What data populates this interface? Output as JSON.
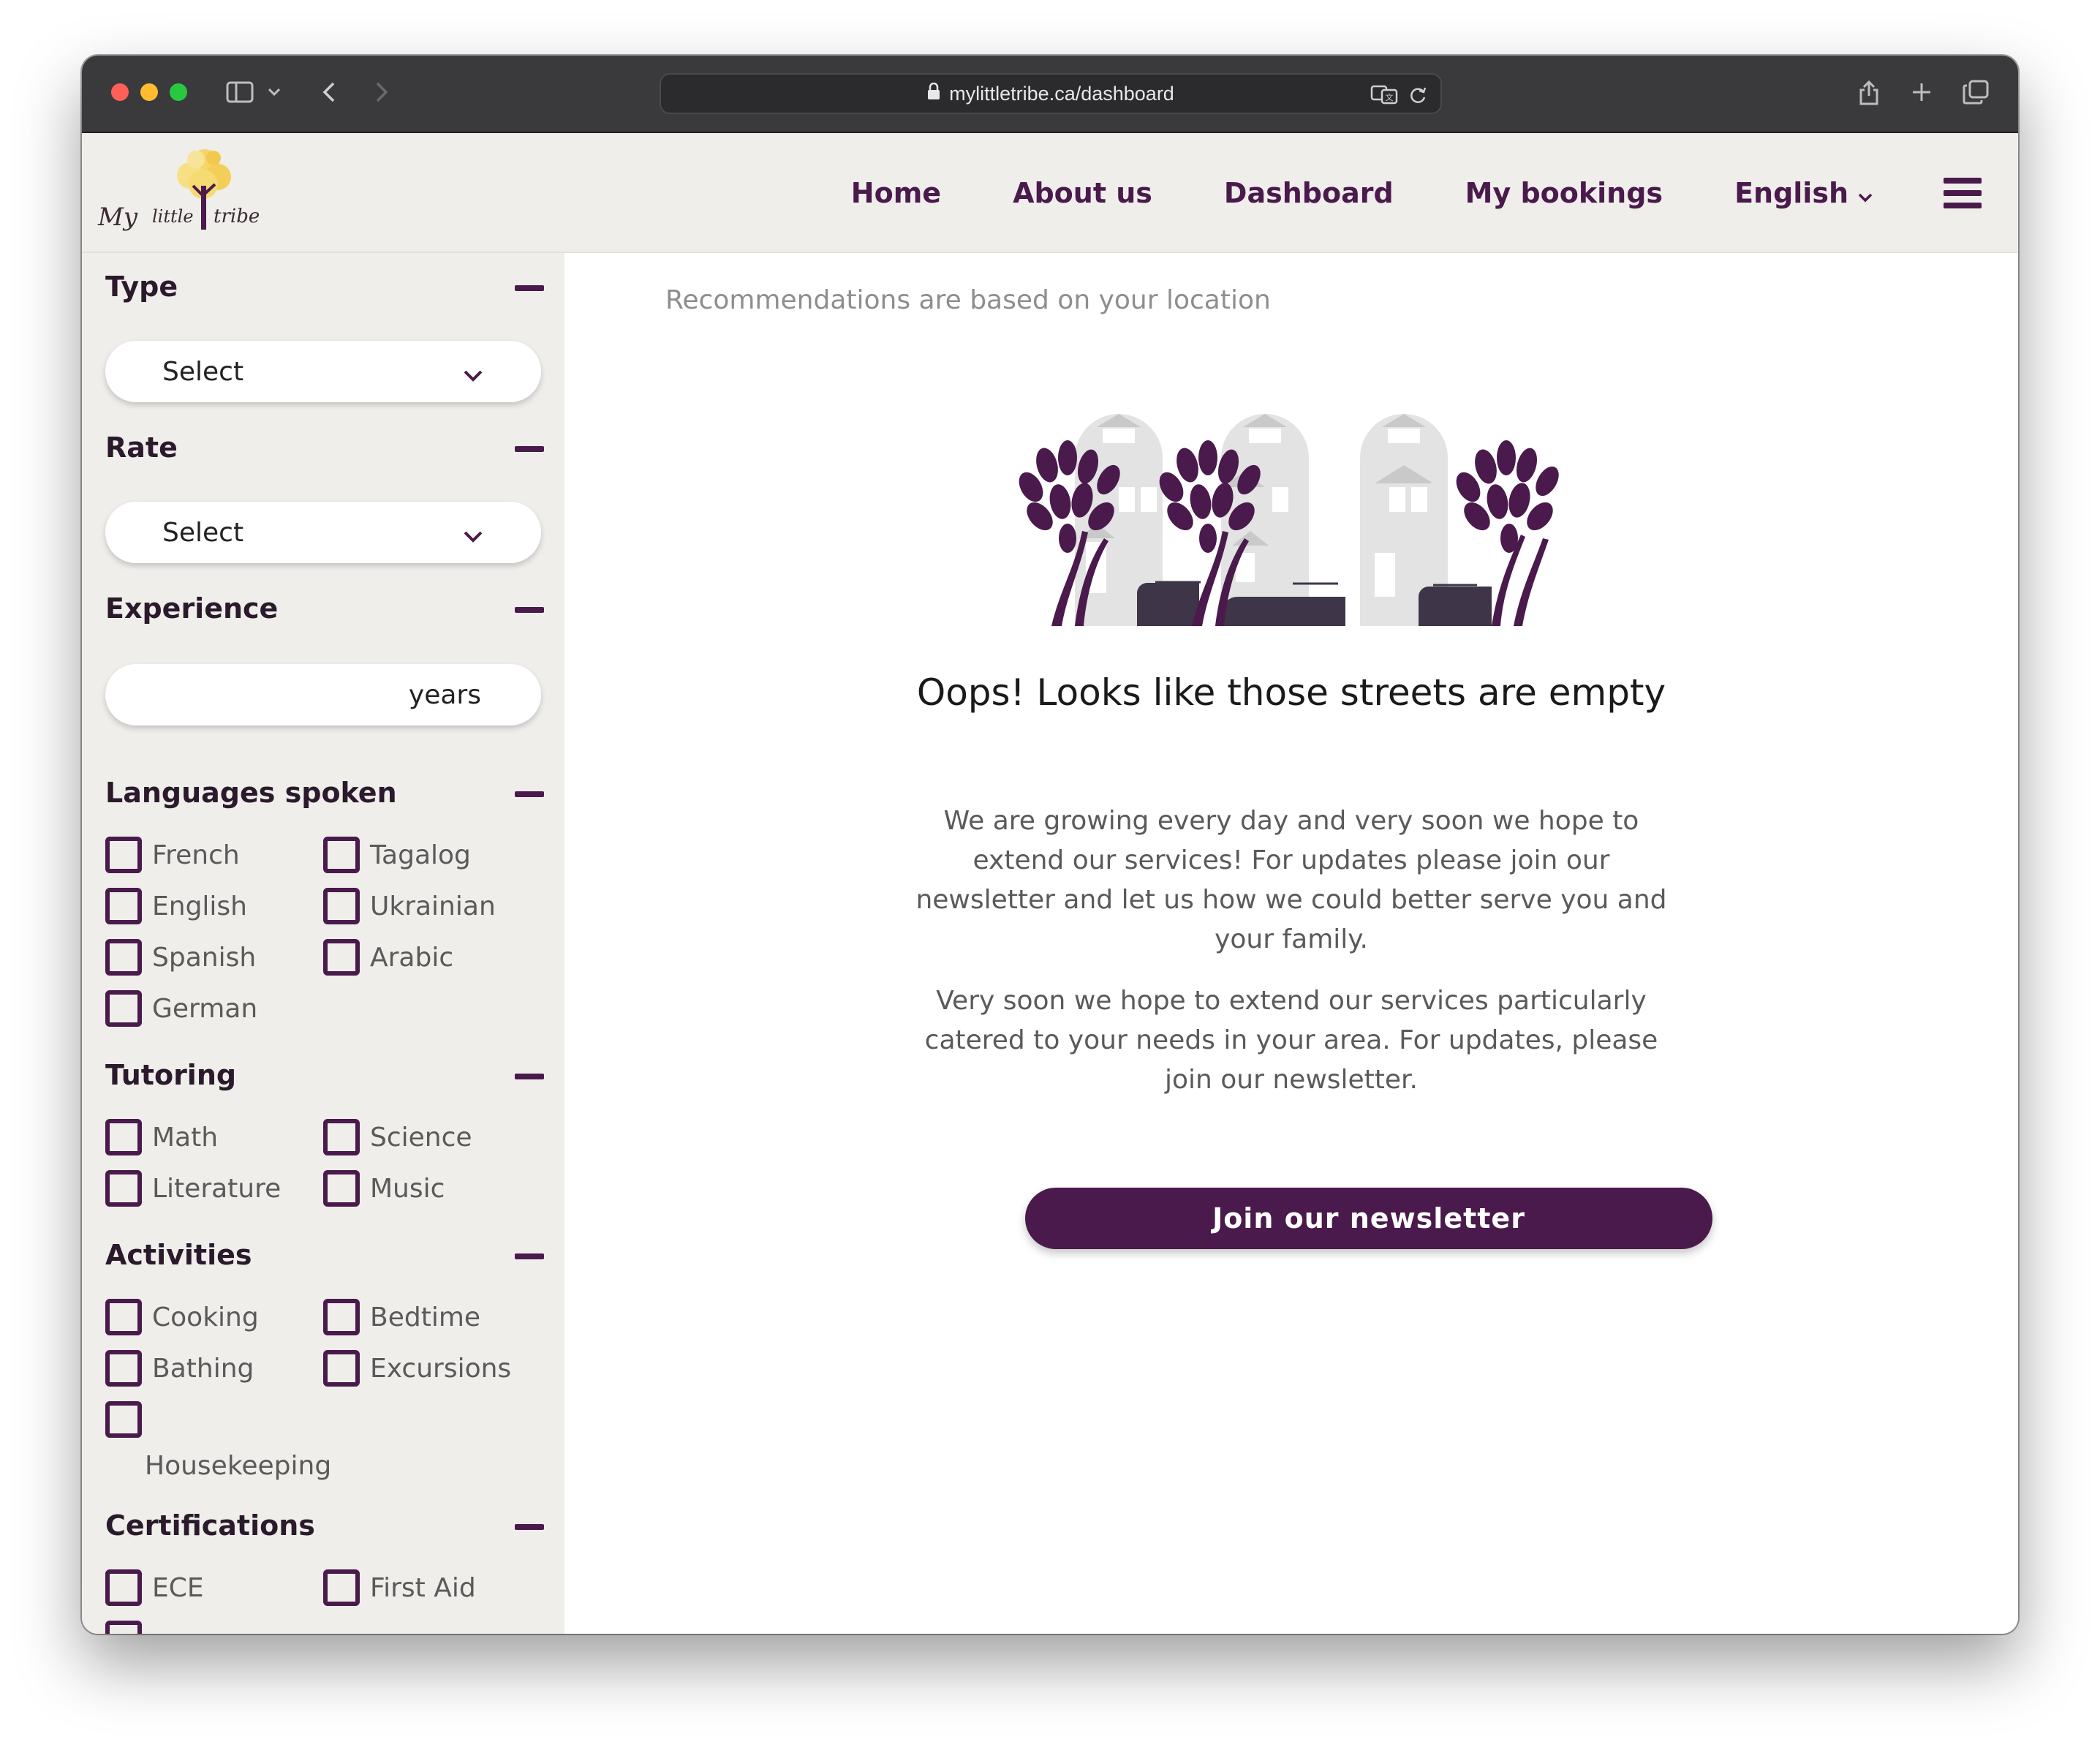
{
  "browser": {
    "url": "mylittletribe.ca/dashboard"
  },
  "site": {
    "logo_text": "My little tribe",
    "nav": {
      "home": "Home",
      "about": "About us",
      "dashboard": "Dashboard",
      "bookings": "My bookings",
      "language": "English"
    }
  },
  "filters": {
    "type": {
      "title": "Type",
      "select_value": "Select"
    },
    "rate": {
      "title": "Rate",
      "select_value": "Select"
    },
    "experience": {
      "title": "Experience",
      "unit": "years"
    },
    "languages": {
      "title": "Languages spoken",
      "options": [
        "French",
        "Tagalog",
        "English",
        "Ukrainian",
        "Spanish",
        "Arabic",
        "German"
      ]
    },
    "tutoring": {
      "title": "Tutoring",
      "options": [
        "Math",
        "Science",
        "Literature",
        "Music"
      ]
    },
    "activities": {
      "title": "Activities",
      "options": [
        "Cooking",
        "Bedtime",
        "Bathing",
        "Excursions",
        "Housekeeping"
      ]
    },
    "certifications": {
      "title": "Certifications",
      "options": [
        "ECE",
        "First Aid"
      ]
    }
  },
  "main": {
    "recommendation_note": "Recommendations are based on your location",
    "empty_title": "Oops! Looks like those streets are empty",
    "paragraph_1": "We are growing every day and very soon we hope to extend our services! For updates please join our newsletter and let us how we could better serve you and your family.",
    "paragraph_2": "Very soon we hope to extend our services particularly catered to your needs in your area. For updates, please join our newsletter.",
    "cta": "Join our newsletter"
  },
  "colors": {
    "brand_purple": "#4a1a4c",
    "sidebar_bg": "#efeeeb",
    "tree_purple": "#4a1a4c",
    "building_grey": "#e3e3e3"
  },
  "icons": {
    "lock": "lock-icon",
    "translate": "translate-icon",
    "reload": "reload-icon",
    "share": "share-icon",
    "new_tab": "plus-icon",
    "tabs": "tabs-icon",
    "sidebar_toggle": "sidebar-icon",
    "back": "back-icon",
    "forward": "forward-icon",
    "menu": "hamburger-icon"
  }
}
